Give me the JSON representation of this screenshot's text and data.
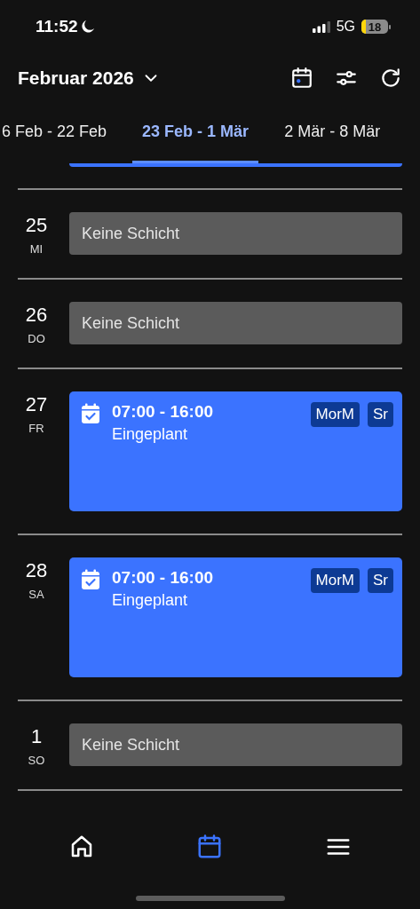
{
  "status_bar": {
    "time": "11:52",
    "network": "5G",
    "battery": "18"
  },
  "header": {
    "title": "Februar 2026"
  },
  "week_tabs": [
    {
      "label": "6 Feb - 22 Feb",
      "selected": false
    },
    {
      "label": "23 Feb - 1 Mär",
      "selected": true
    },
    {
      "label": "2 Mär - 8 Mär",
      "selected": false
    }
  ],
  "days": [
    {
      "day": "25",
      "weekday": "MI",
      "kind": "empty",
      "text": "Keine Schicht"
    },
    {
      "day": "26",
      "weekday": "DO",
      "kind": "empty",
      "text": "Keine Schicht"
    },
    {
      "day": "27",
      "weekday": "FR",
      "kind": "shift",
      "time": "07:00 - 16:00",
      "status": "Eingeplant",
      "tags": [
        "MorM",
        "Sr"
      ]
    },
    {
      "day": "28",
      "weekday": "SA",
      "kind": "shift",
      "time": "07:00 - 16:00",
      "status": "Eingeplant",
      "tags": [
        "MorM",
        "Sr"
      ]
    },
    {
      "day": "1",
      "weekday": "SO",
      "kind": "empty",
      "text": "Keine Schicht"
    }
  ],
  "bottom_nav": [
    {
      "kind": "home",
      "selected": false
    },
    {
      "kind": "calendar",
      "selected": true
    },
    {
      "kind": "menu",
      "selected": false
    }
  ]
}
